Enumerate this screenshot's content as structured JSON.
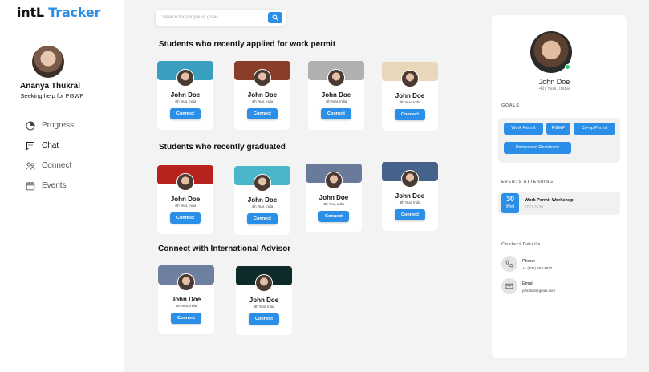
{
  "app": {
    "logo_main": "intL",
    "logo_accent": "Tracker"
  },
  "user": {
    "name": "Ananya Thukral",
    "subtitle": "Seeking help for PGWP"
  },
  "nav": [
    {
      "label": "Progress",
      "icon": "pie-chart-icon"
    },
    {
      "label": "Chat",
      "icon": "chat-icon"
    },
    {
      "label": "Connect",
      "icon": "users-icon"
    },
    {
      "label": "Events",
      "icon": "calendar-icon"
    }
  ],
  "search": {
    "placeholder": "Search for people or goals",
    "icon": "search-icon"
  },
  "sections": [
    {
      "title": "Students who recently applied for work permit"
    },
    {
      "title": "Students who recently graduated"
    },
    {
      "title": "Connect with International Advisor"
    }
  ],
  "cards": [
    {
      "name": "John Doe",
      "meta": "4th Year, India",
      "button": "Connect",
      "banner": "#3a9fbf"
    },
    {
      "name": "John Doe",
      "meta": "4th Year, India",
      "button": "Connect",
      "banner": "#8a3e2a"
    },
    {
      "name": "John Doe",
      "meta": "4th Year, India",
      "button": "Connect",
      "banner": "#b0b0b0"
    },
    {
      "name": "John Doe",
      "meta": "4th Year, India",
      "button": "Connect",
      "banner": "#e8d7b8"
    },
    {
      "name": "John Doe",
      "meta": "4th Year, India",
      "button": "Connect",
      "banner": "#b8221e"
    },
    {
      "name": "John Doe",
      "meta": "4th Year, India",
      "button": "Connect",
      "banner": "#49b6c9"
    },
    {
      "name": "John Doe",
      "meta": "4th Year, India",
      "button": "Connect",
      "banner": "#6a7a9a"
    },
    {
      "name": "John Doe",
      "meta": "4th Year, India",
      "button": "Connect",
      "banner": "#44628a"
    },
    {
      "name": "John Doe",
      "meta": "4th Year, India",
      "button": "Connect",
      "banner": "#6f7f9f"
    },
    {
      "name": "John Doe",
      "meta": "4th Year, India",
      "button": "Connect",
      "banner": "#0f2a2a"
    }
  ],
  "profile": {
    "name": "John Doe",
    "subtitle": "4th Year, India",
    "goals_label": "GOALS",
    "goals": [
      "Work Permit",
      "PGWP",
      "Co-op Permit",
      "Permanent Residency"
    ],
    "events_label": "EVENTS ATTENDING",
    "event": {
      "day": "30",
      "dow": "Wed",
      "title": "Work Permit Workshop",
      "time": "2021-5-30"
    },
    "contact_label": "Contact Details",
    "phone_label": "Phone",
    "phone": "+1 (401) 592-4872",
    "email_label": "Email",
    "email": "johndoe@gmail.com"
  },
  "colors": {
    "accent": "#2b8fe8",
    "online": "#2ecc71"
  }
}
